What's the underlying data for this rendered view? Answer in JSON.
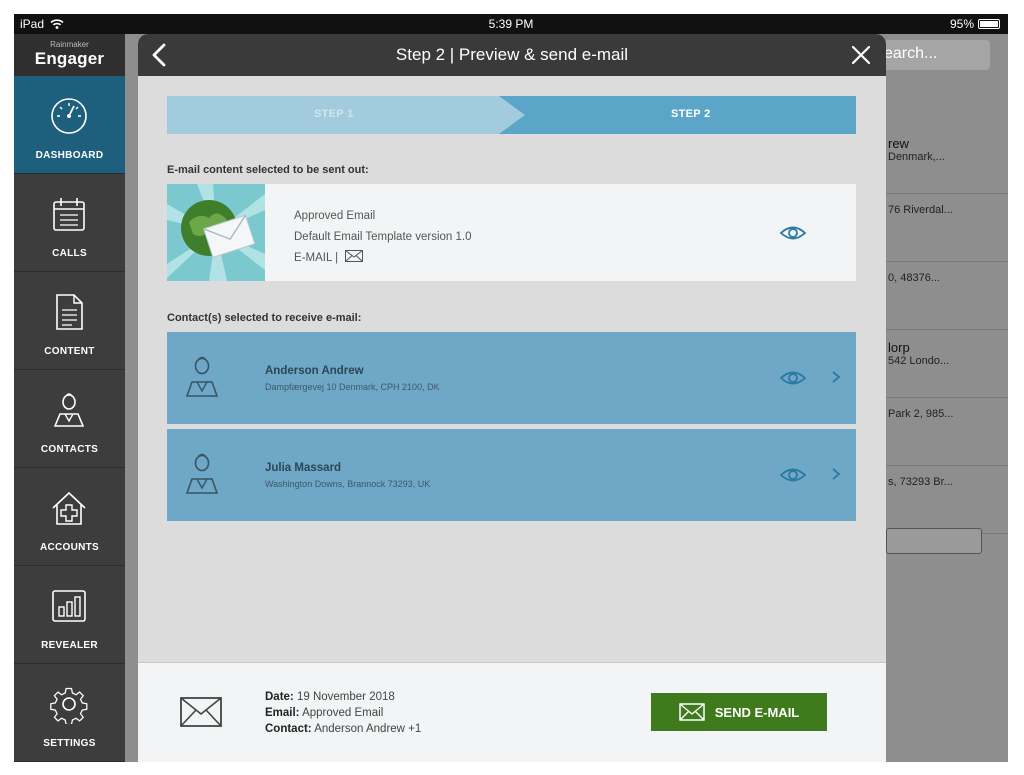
{
  "status_bar": {
    "device": "iPad",
    "time": "5:39 PM",
    "battery": "95%"
  },
  "app": {
    "brand_small": "Rainmaker",
    "brand_name": "Engager"
  },
  "sidebar": {
    "items": [
      {
        "label": "DASHBOARD",
        "icon": "dashboard-gauge-icon",
        "active": true
      },
      {
        "label": "CALLS",
        "icon": "calendar-icon"
      },
      {
        "label": "CONTENT",
        "icon": "document-icon"
      },
      {
        "label": "CONTACTS",
        "icon": "person-icon"
      },
      {
        "label": "ACCOUNTS",
        "icon": "house-plus-icon"
      },
      {
        "label": "REVEALER",
        "icon": "bar-chart-icon"
      },
      {
        "label": "SETTINGS",
        "icon": "gear-icon"
      }
    ]
  },
  "background": {
    "search_placeholder": "earch...",
    "rows": [
      {
        "title": "rew",
        "subtitle": "Denmark,..."
      },
      {
        "title": "",
        "subtitle": "76 Riverdal..."
      },
      {
        "title": "",
        "subtitle": "0, 48376..."
      },
      {
        "title": "lorp",
        "subtitle": "542 Londo..."
      },
      {
        "title": "",
        "subtitle": "Park 2, 985..."
      },
      {
        "title": "",
        "subtitle": "s, 73293 Br..."
      }
    ]
  },
  "modal": {
    "title": "Step 2 | Preview & send e-mail",
    "steps": {
      "step1": "STEP 1",
      "step2": "STEP 2"
    },
    "email_section_title": "E-mail content selected to be sent out:",
    "email": {
      "name": "Approved Email",
      "template": "Default Email Template version 1.0",
      "type": "E-MAIL |"
    },
    "contacts_section_title": "Contact(s) selected to receive e-mail:",
    "contacts": [
      {
        "name": "Anderson Andrew",
        "address": "Dampfærgevej 10 Denmark, CPH 2100, DK"
      },
      {
        "name": "Julia Massard",
        "address": "Washington Downs, Brannock 73293, UK"
      }
    ],
    "footer": {
      "date_label": "Date:",
      "date_value": "19 November 2018",
      "email_label": "Email:",
      "email_value": "Approved Email",
      "contact_label": "Contact:",
      "contact_value": "Anderson Andrew +1",
      "send_label": "SEND E-MAIL"
    }
  },
  "colors": {
    "accent_blue": "#5aa5c8",
    "contact_card": "#6fa7c7",
    "send_green": "#3f7a1d",
    "sidebar_active": "#1e5f7e"
  }
}
